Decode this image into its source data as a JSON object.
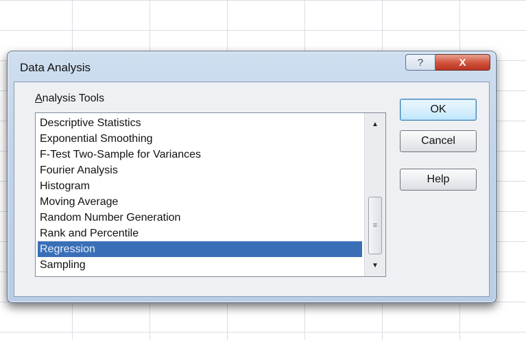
{
  "dialog": {
    "title": "Data Analysis",
    "help_icon": "?",
    "close_icon": "X"
  },
  "analysis_tools": {
    "label_accel": "A",
    "label_rest": "nalysis Tools",
    "items": [
      "Descriptive Statistics",
      "Exponential Smoothing",
      "F-Test Two-Sample for Variances",
      "Fourier Analysis",
      "Histogram",
      "Moving Average",
      "Random Number Generation",
      "Rank and Percentile",
      "Regression",
      "Sampling"
    ],
    "selected": "Regression"
  },
  "buttons": {
    "ok": "OK",
    "cancel": "Cancel",
    "help": "Help"
  },
  "scrollbar": {
    "up_icon": "▲",
    "down_icon": "▼",
    "thumb_grip": "≡"
  },
  "colors": {
    "selection": "#3a6fb8",
    "close_button": "#c9462f"
  }
}
